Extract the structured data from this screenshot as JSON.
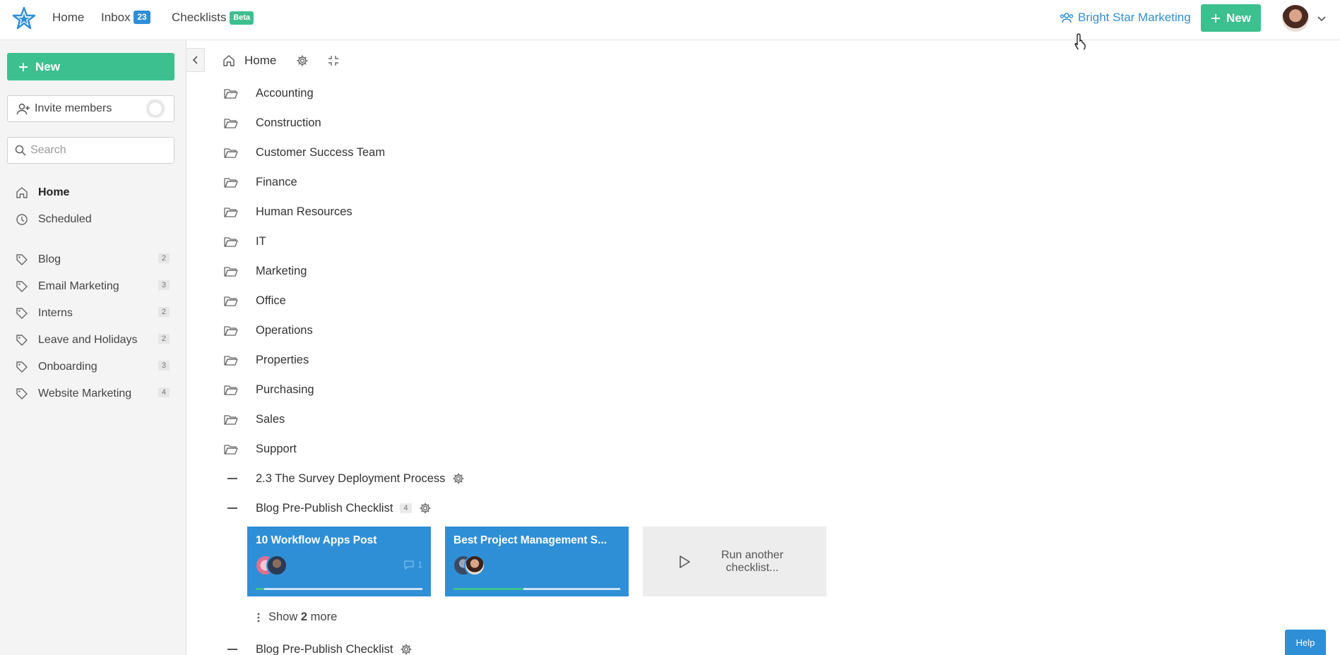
{
  "topnav": {
    "home": "Home",
    "inbox": "Inbox",
    "inbox_count": "23",
    "checklists": "Checklists",
    "checklists_badge": "Beta",
    "org_name": "Bright Star Marketing",
    "new_label": "New"
  },
  "sidebar": {
    "new_label": "New",
    "invite_label": "Invite members",
    "search_placeholder": "Search",
    "nav": [
      {
        "label": "Home",
        "icon": "home-icon"
      },
      {
        "label": "Scheduled",
        "icon": "clock-icon"
      }
    ],
    "tags": [
      {
        "label": "Blog",
        "count": "2"
      },
      {
        "label": "Email Marketing",
        "count": "3"
      },
      {
        "label": "Interns",
        "count": "2"
      },
      {
        "label": "Leave and Holidays",
        "count": "2"
      },
      {
        "label": "Onboarding",
        "count": "3"
      },
      {
        "label": "Website Marketing",
        "count": "4"
      }
    ]
  },
  "main": {
    "breadcrumb": "Home",
    "folders": [
      "Accounting",
      "Construction",
      "Customer Success Team",
      "Finance",
      "Human Resources",
      "IT",
      "Marketing",
      "Office",
      "Operations",
      "Properties",
      "Purchasing",
      "Sales",
      "Support"
    ],
    "checklists": [
      {
        "label": "2.3 The Survey Deployment Process"
      },
      {
        "label": "Blog Pre-Publish Checklist",
        "count": "4"
      },
      {
        "label": "Blog Pre-Publish Checklist"
      }
    ],
    "cards": [
      {
        "title": "10 Workflow Apps Post",
        "comments": "1",
        "progress": 0.05
      },
      {
        "title": "Best Project Management S...",
        "progress": 0.42
      }
    ],
    "run_another": "Run another checklist...",
    "show_prefix": "Show",
    "show_count": "2",
    "show_suffix": "more"
  },
  "help_label": "Help",
  "colors": {
    "accent_green": "#3cc08f",
    "accent_blue": "#2f8fd6"
  }
}
